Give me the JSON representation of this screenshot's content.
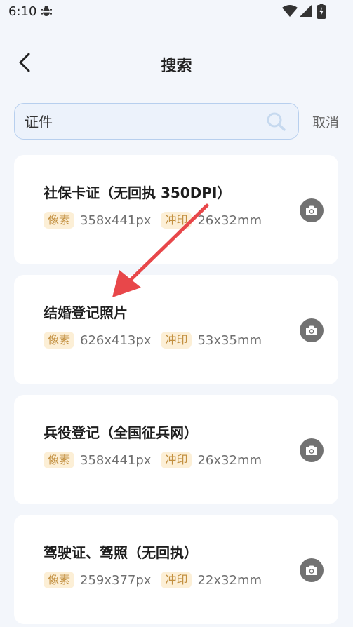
{
  "status_bar": {
    "time": "6:10"
  },
  "header": {
    "title": "搜索"
  },
  "search": {
    "value": "证件",
    "cancel_label": "取消"
  },
  "results": [
    {
      "title": "社保卡证（无回执 350DPI）",
      "pixel_badge": "像素",
      "pixel_value": "358x441px",
      "print_badge": "冲印",
      "print_value": "26x32mm"
    },
    {
      "title": "结婚登记照片",
      "pixel_badge": "像素",
      "pixel_value": "626x413px",
      "print_badge": "冲印",
      "print_value": "53x35mm"
    },
    {
      "title": "兵役登记（全国征兵网）",
      "pixel_badge": "像素",
      "pixel_value": "358x441px",
      "print_badge": "冲印",
      "print_value": "26x32mm"
    },
    {
      "title": "驾驶证、驾照（无回执）",
      "pixel_badge": "像素",
      "pixel_value": "259x377px",
      "print_badge": "冲印",
      "print_value": "22x32mm"
    }
  ],
  "colors": {
    "background": "#f3f6fb",
    "badge_bg": "#fcefd6",
    "badge_text": "#c28f3f",
    "annotation_arrow": "#e8474a"
  }
}
